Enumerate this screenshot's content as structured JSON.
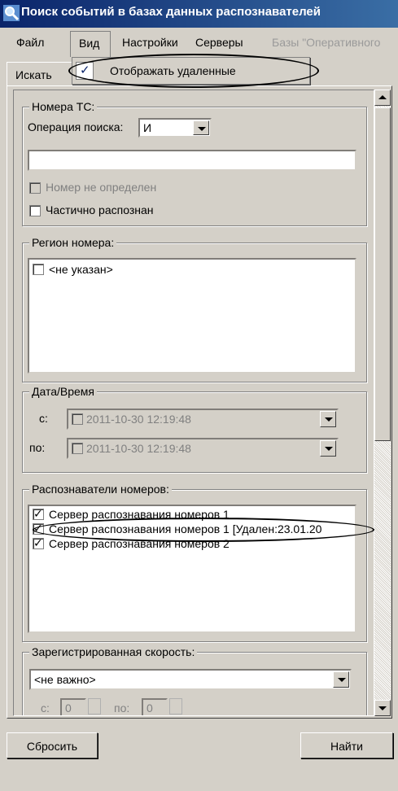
{
  "window": {
    "title": "Поиск событий в базах данных распознавателей",
    "icon": "search-icon"
  },
  "menu": {
    "file": "Файл",
    "view": "Вид",
    "settings": "Настройки",
    "servers": "Серверы",
    "db": "Базы \"Оперативного"
  },
  "dropdown": {
    "show_deleted": "Отображать удаленные",
    "checked": true
  },
  "tab": {
    "label": "Искать"
  },
  "plate_group": {
    "title": "Номера ТС:",
    "operation_label": "Операция поиска:",
    "operation_value": "И",
    "plate_input_value": "",
    "not_detected": "Номер не определен",
    "partial": "Частично распознан"
  },
  "region_group": {
    "title": "Регион номера:",
    "items": [
      {
        "label": "<не указан>",
        "checked": false
      }
    ]
  },
  "datetime_group": {
    "title": "Дата/Время",
    "from_label": "с:",
    "to_label": "по:",
    "from_value": "2011-10-30 12:19:48",
    "to_value": "2011-10-30 12:19:48"
  },
  "recognizers_group": {
    "title": "Распознаватели номеров:",
    "items": [
      {
        "label": "Сервер распознавания номеров 1",
        "checked": true
      },
      {
        "label": "Сервер распознавания номеров 1 [Удален:23.01.20",
        "checked": true
      },
      {
        "label": "Сервер распознавания номеров 2",
        "checked": true
      }
    ]
  },
  "speed_group": {
    "title": "Зарегистрированная скорость:",
    "combo_value": "<не важно>",
    "from_label": "с:",
    "from_value": "0",
    "to_label": "по:",
    "to_value": "0"
  },
  "buttons": {
    "reset": "Сбросить",
    "find": "Найти"
  }
}
